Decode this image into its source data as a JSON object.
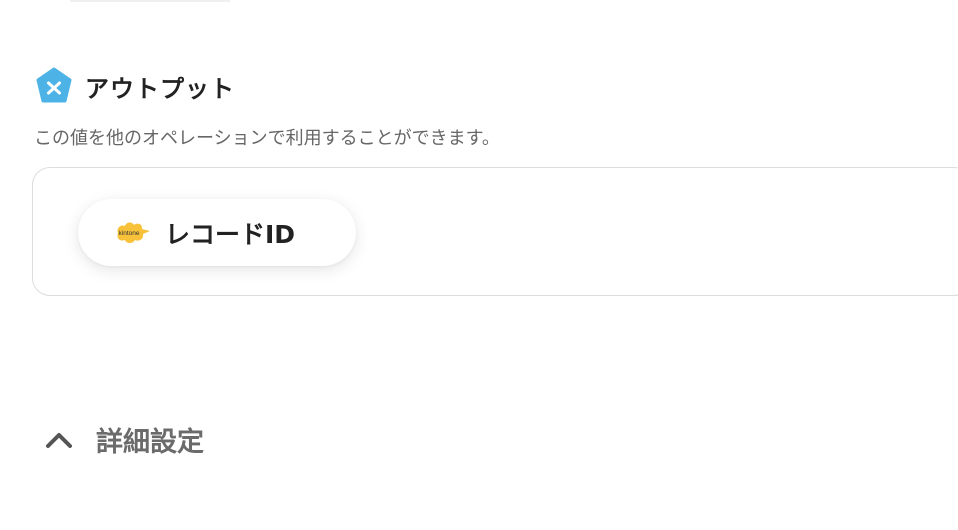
{
  "output_section": {
    "icon": "variable-x-pentagon-icon",
    "icon_color": "#4db3e6",
    "title": "アウトプット",
    "description": "この値を他のオペレーションで利用することができます。"
  },
  "outputs": [
    {
      "app_icon": "kintone-icon",
      "app_icon_text": "kintone",
      "app_icon_color": "#f7c23a",
      "label": "レコードID"
    }
  ],
  "advanced_settings": {
    "icon": "chevron-up-icon",
    "label": "詳細設定"
  }
}
